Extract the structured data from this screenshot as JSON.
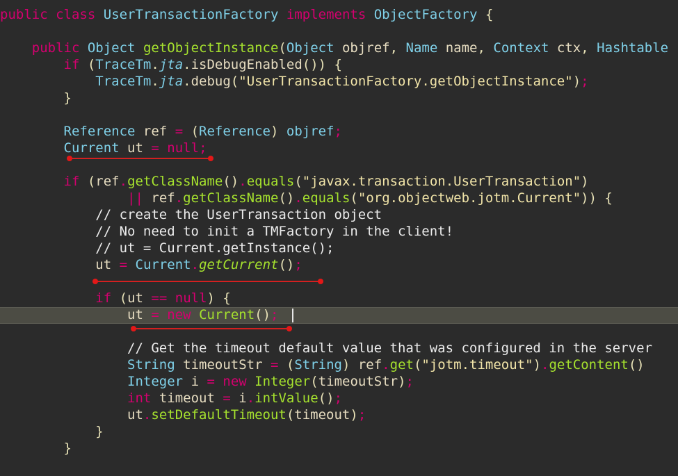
{
  "editor": {
    "theme_colors": {
      "background": "#2b2b2b",
      "keyword": "#d4006f",
      "type": "#7fd0e8",
      "method": "#a6e22e",
      "string": "#f1e4a8",
      "highlight_line": "#4c4c44",
      "underline": "#d42020"
    },
    "lines": [
      {
        "tokens": [
          [
            "kw",
            "public"
          ],
          [
            "pu",
            " "
          ],
          [
            "kw",
            "class"
          ],
          [
            "pu",
            " "
          ],
          [
            "ty",
            "UserTransactionFactory"
          ],
          [
            "pu",
            " "
          ],
          [
            "kw",
            "implements"
          ],
          [
            "pu",
            " "
          ],
          [
            "ty",
            "ObjectFactory"
          ],
          [
            "pu",
            " {"
          ]
        ]
      },
      {
        "tokens": []
      },
      {
        "tokens": [
          [
            "pu",
            "    "
          ],
          [
            "kw",
            "public"
          ],
          [
            "pu",
            " "
          ],
          [
            "ty",
            "Object"
          ],
          [
            "pu",
            " "
          ],
          [
            "fn",
            "getObjectInstance"
          ],
          [
            "pu",
            "("
          ],
          [
            "ty",
            "Object"
          ],
          [
            "pu",
            " "
          ],
          [
            "vr",
            "objref"
          ],
          [
            "pu",
            ", "
          ],
          [
            "ty",
            "Name"
          ],
          [
            "pu",
            " "
          ],
          [
            "vr",
            "name"
          ],
          [
            "pu",
            ", "
          ],
          [
            "ty",
            "Context"
          ],
          [
            "pu",
            " "
          ],
          [
            "vr",
            "ctx"
          ],
          [
            "pu",
            ", "
          ],
          [
            "ty",
            "Hashtable"
          ]
        ]
      },
      {
        "tokens": [
          [
            "pu",
            "        "
          ],
          [
            "kw",
            "if"
          ],
          [
            "pu",
            " ("
          ],
          [
            "ty",
            "TraceTm"
          ],
          [
            "pu",
            "."
          ],
          [
            "ty it",
            "jta"
          ],
          [
            "pu",
            "."
          ],
          [
            "vr",
            "isDebugEnabled"
          ],
          [
            "pu",
            "()) {"
          ]
        ]
      },
      {
        "tokens": [
          [
            "pu",
            "            "
          ],
          [
            "ty",
            "TraceTm"
          ],
          [
            "pu",
            "."
          ],
          [
            "ty it",
            "jta"
          ],
          [
            "pu",
            "."
          ],
          [
            "vr",
            "debug"
          ],
          [
            "pu",
            "("
          ],
          [
            "st",
            "\"UserTransactionFactory.getObjectInstance\""
          ],
          [
            "pu",
            ")"
          ],
          [
            "kw",
            ";"
          ]
        ]
      },
      {
        "tokens": [
          [
            "pu",
            "        }"
          ]
        ]
      },
      {
        "tokens": []
      },
      {
        "tokens": [
          [
            "pu",
            "        "
          ],
          [
            "ty",
            "Reference"
          ],
          [
            "pu",
            " "
          ],
          [
            "vr",
            "ref"
          ],
          [
            "pu",
            " "
          ],
          [
            "kw",
            "="
          ],
          [
            "pu",
            " ("
          ],
          [
            "ty",
            "Reference"
          ],
          [
            "pu",
            ") "
          ],
          [
            "ty",
            "objref"
          ],
          [
            "kw",
            ";"
          ]
        ]
      },
      {
        "tokens": [
          [
            "pu",
            "        "
          ],
          [
            "ty",
            "Current"
          ],
          [
            "pu",
            " "
          ],
          [
            "vr",
            "ut"
          ],
          [
            "pu",
            " "
          ],
          [
            "kw",
            "="
          ],
          [
            "pu",
            " "
          ],
          [
            "kw",
            "null"
          ],
          [
            "kw",
            ";"
          ]
        ]
      },
      {
        "tokens": []
      },
      {
        "tokens": [
          [
            "pu",
            "        "
          ],
          [
            "kw",
            "if"
          ],
          [
            "pu",
            " ("
          ],
          [
            "vr",
            "ref"
          ],
          [
            "kw",
            "."
          ],
          [
            "fn",
            "getClassName"
          ],
          [
            "pu",
            "()"
          ],
          [
            "kw",
            "."
          ],
          [
            "fn",
            "equals"
          ],
          [
            "pu",
            "("
          ],
          [
            "st",
            "\"javax.transaction.UserTransaction\""
          ],
          [
            "pu",
            ")"
          ]
        ]
      },
      {
        "tokens": [
          [
            "pu",
            "                "
          ],
          [
            "kw",
            "||"
          ],
          [
            "pu",
            " "
          ],
          [
            "vr",
            "ref"
          ],
          [
            "kw",
            "."
          ],
          [
            "fn",
            "getClassName"
          ],
          [
            "pu",
            "()"
          ],
          [
            "kw",
            "."
          ],
          [
            "fn",
            "equals"
          ],
          [
            "pu",
            "("
          ],
          [
            "st",
            "\"org.objectweb.jotm.Current\""
          ],
          [
            "pu",
            ")) {"
          ]
        ]
      },
      {
        "tokens": [
          [
            "pu",
            "            "
          ],
          [
            "cm",
            "// create the UserTransaction object"
          ]
        ]
      },
      {
        "tokens": [
          [
            "pu",
            "            "
          ],
          [
            "cm",
            "// No need to init a TMFactory in the client!"
          ]
        ]
      },
      {
        "tokens": [
          [
            "pu",
            "            "
          ],
          [
            "cm",
            "// ut = Current.getInstance();"
          ]
        ]
      },
      {
        "tokens": [
          [
            "pu",
            "            "
          ],
          [
            "vr",
            "ut"
          ],
          [
            "pu",
            " "
          ],
          [
            "kw",
            "="
          ],
          [
            "pu",
            " "
          ],
          [
            "ty",
            "Current"
          ],
          [
            "kw",
            "."
          ],
          [
            "fn it",
            "getCurrent"
          ],
          [
            "pu",
            "()"
          ],
          [
            "kw",
            ";"
          ]
        ]
      },
      {
        "tokens": []
      },
      {
        "tokens": [
          [
            "pu",
            "            "
          ],
          [
            "kw",
            "if"
          ],
          [
            "pu",
            " ("
          ],
          [
            "vr",
            "ut"
          ],
          [
            "pu",
            " "
          ],
          [
            "kw",
            "=="
          ],
          [
            "pu",
            " "
          ],
          [
            "kw",
            "null"
          ],
          [
            "pu",
            ") {"
          ]
        ]
      },
      {
        "tokens": [
          [
            "pu",
            "                "
          ],
          [
            "vr",
            "ut"
          ],
          [
            "pu",
            " "
          ],
          [
            "kw",
            "="
          ],
          [
            "pu",
            " "
          ],
          [
            "kw",
            "new"
          ],
          [
            "pu",
            " "
          ],
          [
            "fn",
            "Current"
          ],
          [
            "pu",
            "()"
          ],
          [
            "kw",
            ";"
          ]
        ]
      },
      {
        "tokens": []
      },
      {
        "tokens": [
          [
            "pu",
            "                "
          ],
          [
            "cm",
            "// Get the timeout default value that was configured in the server"
          ]
        ]
      },
      {
        "tokens": [
          [
            "pu",
            "                "
          ],
          [
            "ty",
            "String"
          ],
          [
            "pu",
            " "
          ],
          [
            "vr",
            "timeoutStr"
          ],
          [
            "pu",
            " "
          ],
          [
            "kw",
            "="
          ],
          [
            "pu",
            " ("
          ],
          [
            "ty",
            "String"
          ],
          [
            "pu",
            ") "
          ],
          [
            "vr",
            "ref"
          ],
          [
            "kw",
            "."
          ],
          [
            "fn",
            "get"
          ],
          [
            "pu",
            "("
          ],
          [
            "st",
            "\"jotm.timeout\""
          ],
          [
            "pu",
            ")"
          ],
          [
            "kw",
            "."
          ],
          [
            "fn",
            "getContent"
          ],
          [
            "pu",
            "()"
          ]
        ]
      },
      {
        "tokens": [
          [
            "pu",
            "                "
          ],
          [
            "ty",
            "Integer"
          ],
          [
            "pu",
            " "
          ],
          [
            "vr",
            "i"
          ],
          [
            "pu",
            " "
          ],
          [
            "kw",
            "="
          ],
          [
            "pu",
            " "
          ],
          [
            "kw",
            "new"
          ],
          [
            "pu",
            " "
          ],
          [
            "fn",
            "Integer"
          ],
          [
            "pu",
            "("
          ],
          [
            "vr",
            "timeoutStr"
          ],
          [
            "pu",
            ")"
          ],
          [
            "kw",
            ";"
          ]
        ]
      },
      {
        "tokens": [
          [
            "pu",
            "                "
          ],
          [
            "kw",
            "int"
          ],
          [
            "pu",
            " "
          ],
          [
            "vr",
            "timeout"
          ],
          [
            "pu",
            " "
          ],
          [
            "kw",
            "="
          ],
          [
            "pu",
            " "
          ],
          [
            "vr",
            "i"
          ],
          [
            "kw",
            "."
          ],
          [
            "fn",
            "intValue"
          ],
          [
            "pu",
            "()"
          ],
          [
            "kw",
            ";"
          ]
        ]
      },
      {
        "tokens": [
          [
            "pu",
            "                "
          ],
          [
            "vr",
            "ut"
          ],
          [
            "kw",
            "."
          ],
          [
            "fn",
            "setDefaultTimeout"
          ],
          [
            "pu",
            "("
          ],
          [
            "vr",
            "timeout"
          ],
          [
            "pu",
            ")"
          ],
          [
            "kw",
            ";"
          ]
        ]
      },
      {
        "tokens": [
          [
            "pu",
            "            }"
          ]
        ]
      },
      {
        "tokens": [
          [
            "pu",
            "        }"
          ]
        ]
      }
    ]
  }
}
